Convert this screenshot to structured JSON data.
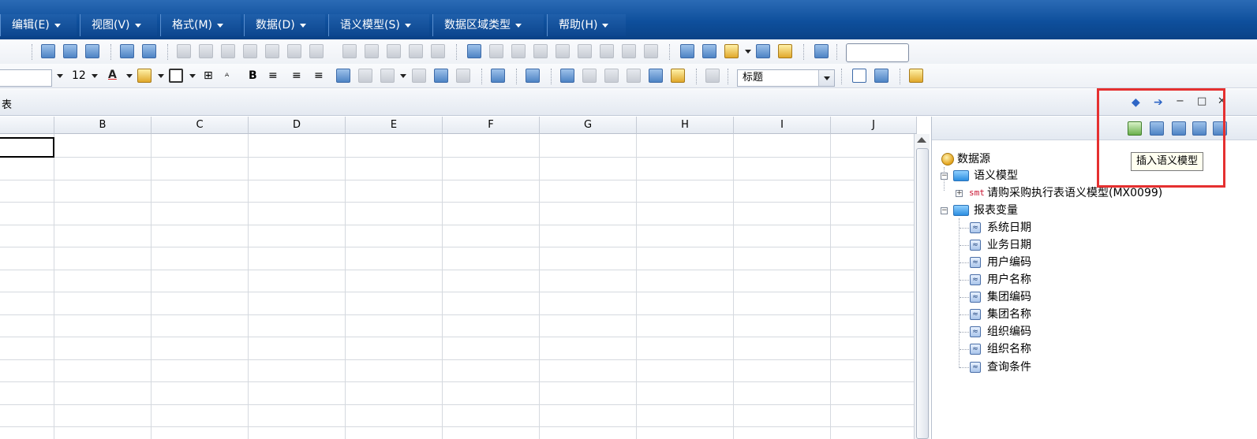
{
  "menu": {
    "items": [
      {
        "label": "编辑(E)"
      },
      {
        "label": "视图(V)"
      },
      {
        "label": "格式(M)"
      },
      {
        "label": "数据(D)"
      },
      {
        "label": "语义模型(S)"
      },
      {
        "label": "数据区域类型"
      },
      {
        "label": "帮助(H)"
      }
    ]
  },
  "toolbar": {
    "font_size": "12",
    "style_select_value": "标题",
    "search_value": ""
  },
  "panel": {
    "left_title_fragment": "表"
  },
  "sheet": {
    "columns": [
      "B",
      "C",
      "D",
      "E",
      "F",
      "G",
      "H",
      "I",
      "J"
    ]
  },
  "tree": {
    "root": "数据源",
    "semantic_folder": "语义模型",
    "smt_tag": "smt",
    "semantic_item": "请购采购执行表语义模型(MX0099)",
    "report_folder": "报表变量",
    "variables": [
      "系统日期",
      "业务日期",
      "用户编码",
      "用户名称",
      "集团编码",
      "集团名称",
      "组织编码",
      "组织名称",
      "查询条件"
    ]
  },
  "tooltip": {
    "text": "插入语义模型"
  },
  "colors": {
    "menubar": "#0e4f9c",
    "highlight": "#e53030",
    "accent_icon": "#2f66c6"
  }
}
